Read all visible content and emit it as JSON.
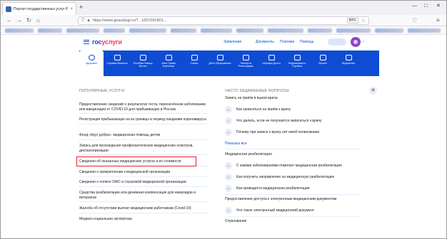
{
  "browser": {
    "tab_title": "Портал государственных услуг Р...",
    "tab_close": "×",
    "new_tab": "+",
    "win_min": "—",
    "win_max": "□",
    "win_close": "✕",
    "back": "←",
    "forward": "→",
    "reload": "↻",
    "home": "⌂",
    "url": "https://www.gosuslugi.ru/?...1657091801...",
    "zoom": "80%",
    "star": "☆",
    "save": "♡",
    "menu": "≡"
  },
  "header": {
    "logo_part1": "гос",
    "logo_part2": "услуги",
    "links": [
      "Заявления",
      "Документы",
      "Платежи",
      "Помощь"
    ],
    "avatar_chevron": "⌄",
    "brand_color": "#0d4cd3",
    "accent_color": "#ee3f58"
  },
  "categories": [
    {
      "label": "Здоровье",
      "active": true
    },
    {
      "label": "Справки Выписки"
    },
    {
      "label": "Пособия Овощи Льготы"
    },
    {
      "label": "Авто Права Транспорт"
    },
    {
      "label": "Семья"
    },
    {
      "label": "Дети Образование"
    },
    {
      "label": "Паспорта Регистрация"
    },
    {
      "label": "Штрафы Долги"
    },
    {
      "label": "Недвижимость Стройка"
    },
    {
      "label": "Прочее"
    },
    {
      "label": "Ведомства"
    }
  ],
  "popular": {
    "title": "ПОПУЛЯРНЫЕ УСЛУГИ",
    "items": [
      "Предоставление сведений о результатах теста, перенесённом заболевании или вакцинации от COVID-19 для прибывающих в Россию",
      "Регистрация прибывающих из-за границы в период пандемии коронавируса",
      "Фонд «Круг добра»: медицинская помощь детям",
      "Запись для прохождения профилактических медицинских осмотров, диспансеризации",
      "Сведения об оказанных медицинских услугах и их стоимости",
      "Сведения о прикреплении к медицинской организации",
      "Сведения о полисе ОМС и страховой медицинской организации",
      "Средства реабилитации или денежная компенсация для инвалидов и ветеранов",
      "Жалоба об отсутствии выплат медицинским работникам (Covid-19)",
      "Медико-социальная экспертиза"
    ]
  },
  "faq": {
    "title": "ЧАСТО ЗАДАВАЕМЫЕ ВОПРОСЫ",
    "close": "✕",
    "chevron": "⌄",
    "group1": "Запись на приём и вызов врача",
    "group1_items": [
      "Как записаться на приём к врачу",
      "Что делать, если не получается записаться к врачу",
      "Почему при записи к врачу нет моей поликлиники"
    ],
    "show_all": "Показать все",
    "group2": "Медицинская реабилитация",
    "group2_items": [
      "С какими заболеваниями помогает медицинская реабилитация",
      "Как получить направление на медицинскую реабилитацию",
      "Как проводится медицинская реабилитация"
    ],
    "group3": "Предоставление доступа к электронным медицинским документам",
    "group3_items": [
      "Что такое электронный медицинский документ"
    ],
    "group4": "Страхование"
  }
}
